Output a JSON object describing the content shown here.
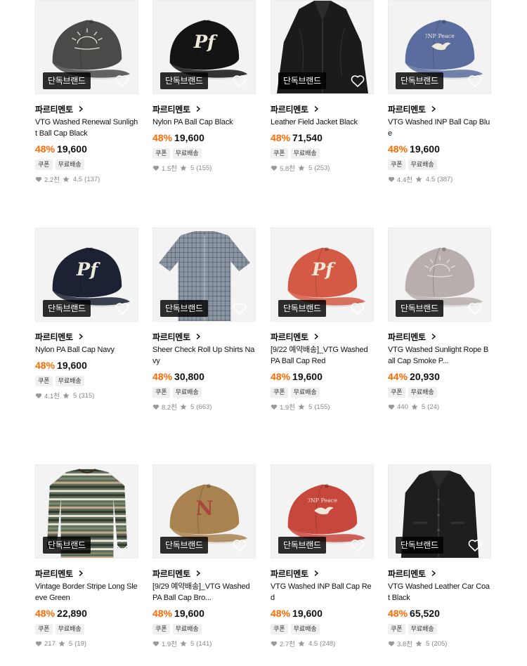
{
  "rows": [
    {
      "items": [
        {
          "badge": "단독브랜드",
          "brand": "파르티멘토",
          "name": "VTG Washed Renewal Sunlight Ball Cap Black",
          "discount": "48%",
          "price": "19,600",
          "tags": [
            "쿠폰",
            "무료배송"
          ],
          "likes": "2.2천",
          "rating": "4.5",
          "reviews": "(137)",
          "image": "cap",
          "color": "#4a4a48",
          "logo": "sun"
        },
        {
          "badge": "단독브랜드",
          "brand": "파르티멘토",
          "name": "Nylon PA Ball Cap Black",
          "discount": "48%",
          "price": "19,600",
          "tags": [
            "쿠폰",
            "무료배송"
          ],
          "likes": "1.5천",
          "rating": "5",
          "reviews": "(155)",
          "image": "cap",
          "color": "#141414",
          "logo": "pa"
        },
        {
          "badge": "단독브랜드",
          "brand": "파르티멘토",
          "name": "Leather Field Jacket Black",
          "discount": "48%",
          "price": "71,540",
          "tags": [
            "쿠폰",
            "무료배송"
          ],
          "likes": "5.8천",
          "rating": "5",
          "reviews": "(253)",
          "image": "jacket",
          "color": "#1b1b1b",
          "logo": ""
        },
        {
          "badge": "단독브랜드",
          "brand": "파르티멘토",
          "name": "VTG Washed INP Ball Cap Blue",
          "discount": "48%",
          "price": "19,600",
          "tags": [
            "쿠폰",
            "무료배송"
          ],
          "likes": "4.4천",
          "rating": "4.5",
          "reviews": "(387)",
          "image": "cap",
          "color": "#5b6d9e",
          "logo": "dove"
        }
      ]
    },
    {
      "items": [
        {
          "badge": "단독브랜드",
          "brand": "파르티멘토",
          "name": "Nylon PA Ball Cap Navy",
          "discount": "48%",
          "price": "19,600",
          "tags": [
            "쿠폰",
            "무료배송"
          ],
          "likes": "4.1천",
          "rating": "5",
          "reviews": "(315)",
          "image": "cap",
          "color": "#1c2233",
          "logo": "pa"
        },
        {
          "badge": "단독브랜드",
          "brand": "파르티멘토",
          "name": "Sheer Check Roll Up Shirts Navy",
          "discount": "48%",
          "price": "30,800",
          "tags": [
            "쿠폰",
            "무료배송"
          ],
          "likes": "8.2천",
          "rating": "5",
          "reviews": "(663)",
          "image": "shirt",
          "color": "#5a6575",
          "logo": ""
        },
        {
          "badge": "단독브랜드",
          "brand": "파르티멘토",
          "name": "[9/22 예약배송]_VTG Washed PA Ball Cap Red",
          "discount": "48%",
          "price": "19,600",
          "tags": [
            "쿠폰",
            "무료배송"
          ],
          "likes": "1.9천",
          "rating": "5",
          "reviews": "(155)",
          "image": "cap",
          "color": "#d55a45",
          "logo": "pa"
        },
        {
          "badge": "단독브랜드",
          "brand": "파르티멘토",
          "name": "VTG Washed Sunlight Rope Ball Cap Smoke P...",
          "discount": "44%",
          "price": "20,930",
          "tags": [
            "쿠폰",
            "무료배송"
          ],
          "likes": "440",
          "rating": "5",
          "reviews": "(24)",
          "image": "cap",
          "color": "#b8aeae",
          "logo": "sun"
        }
      ]
    },
    {
      "items": [
        {
          "badge": "단독브랜드",
          "brand": "파르티멘토",
          "name": "Vintage Border Stripe Long Sleeve Green",
          "discount": "48%",
          "price": "22,890",
          "tags": [
            "쿠폰",
            "무료배송"
          ],
          "likes": "217",
          "rating": "5",
          "reviews": "(19)",
          "image": "stripe",
          "color": "#5d6a5a",
          "logo": ""
        },
        {
          "badge": "단독브랜드",
          "brand": "파르티멘토",
          "name": "[9/29 예약배송]_VTG Washed PA Ball Cap Bro...",
          "discount": "48%",
          "price": "19,600",
          "tags": [
            "쿠폰",
            "무료배송"
          ],
          "likes": "1.9천",
          "rating": "5",
          "reviews": "(141)",
          "image": "cap",
          "color": "#a8834f",
          "logo": "n"
        },
        {
          "badge": "단독브랜드",
          "brand": "파르티멘토",
          "name": "VTG Washed INP Ball Cap Red",
          "discount": "48%",
          "price": "19,600",
          "tags": [
            "쿠폰",
            "무료배송"
          ],
          "likes": "2.7천",
          "rating": "4.5",
          "reviews": "(248)",
          "image": "cap",
          "color": "#c8473c",
          "logo": "dove"
        },
        {
          "badge": "단독브랜드",
          "brand": "파르티멘토",
          "name": "VTG Washed Leather Car Coat Black",
          "discount": "48%",
          "price": "65,520",
          "tags": [
            "쿠폰",
            "무료배송"
          ],
          "likes": "3.8천",
          "rating": "5",
          "reviews": "(205)",
          "image": "coat",
          "color": "#1e1e1e",
          "logo": ""
        }
      ]
    }
  ],
  "icons": {
    "heart": "heart-outline-icon",
    "chevron": "chevron-right-icon",
    "like": "heart-filled-icon",
    "star": "star-icon"
  },
  "colors": {
    "discount": "#ff6a00",
    "badge_bg": "#000000",
    "tag_bg": "#f0f0f0",
    "meta": "#888888"
  }
}
